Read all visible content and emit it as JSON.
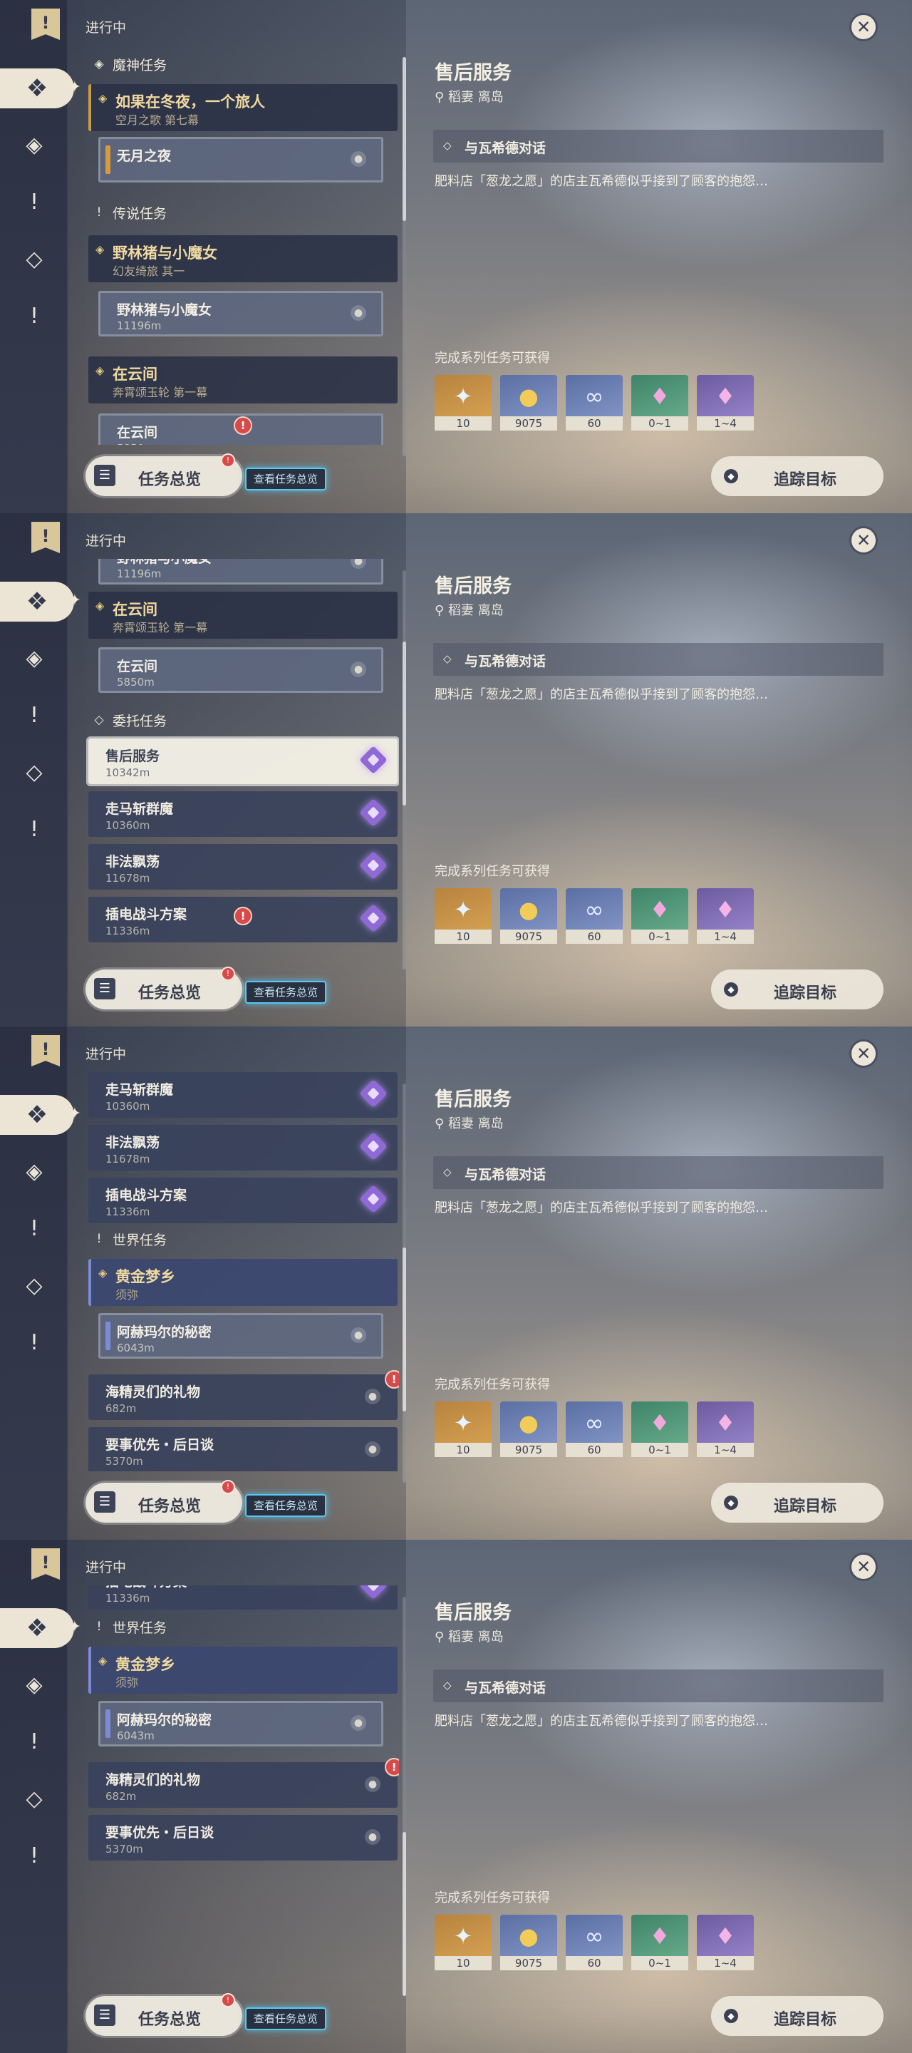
{
  "header": {
    "status_title": "进行中",
    "close_glyph": "✕"
  },
  "icons": {
    "quest_book": "quest-book-icon",
    "archon": "archon-quest-icon",
    "story": "story-quest-icon",
    "legend": "legend-quest-icon",
    "world": "world-quest-icon",
    "commission": "commission-quest-icon"
  },
  "detail": {
    "title": "售后服务",
    "location": "稻妻 离岛",
    "objective": "与瓦希德对话",
    "description": "肥料店「葱龙之愿」的店主瓦希德似乎接到了顾客的抱怨…",
    "rewards_label": "完成系列任务可获得",
    "rewards": [
      {
        "icon": "primogem-icon",
        "count": "10",
        "color": "#c58f46"
      },
      {
        "icon": "mora-icon",
        "count": "9075",
        "color": "#6c80b5"
      },
      {
        "icon": "companionship-exp-icon",
        "count": "60",
        "color": "#6c80b5"
      },
      {
        "icon": "crystal-green-icon",
        "count": "0~1",
        "color": "#4f9476"
      },
      {
        "icon": "crystal-purple-icon",
        "count": "1~4",
        "color": "#8070b5"
      }
    ]
  },
  "footer": {
    "overview_label": "任务总览",
    "overview_tag": "查看任务总览",
    "overview_alert": "!",
    "track_label": "追踪目标"
  },
  "categories": {
    "archon": "魔神任务",
    "legend": "传说任务",
    "commission": "委托任务",
    "world": "世界任务"
  },
  "quests": {
    "winter_night": {
      "title": "如果在冬夜，一个旅人",
      "sub": "空月之歌 第七幕"
    },
    "moonless": {
      "title": "无月之夜"
    },
    "boar_group": {
      "title": "野林猪与小魔女",
      "sub": "幻友绮旅 其一"
    },
    "boar_item": {
      "title": "野林猪与小魔女",
      "dist": "11196m"
    },
    "clouds_group": {
      "title": "在云间",
      "sub": "奔霄颂玉轮 第一幕"
    },
    "clouds_item": {
      "title": "在云间",
      "dist": "5850m"
    },
    "after_sales": {
      "title": "售后服务",
      "dist": "10342m"
    },
    "zouma": {
      "title": "走马斩群魔",
      "dist": "10360m"
    },
    "feifa": {
      "title": "非法飘荡",
      "dist": "11678m"
    },
    "chadian": {
      "title": "插电战斗方案",
      "dist": "11336m"
    },
    "golden_group": {
      "title": "黄金梦乡",
      "sub": "须弥"
    },
    "ahemar": {
      "title": "阿赫玛尔的秘密",
      "dist": "6043m"
    },
    "sea_spirits": {
      "title": "海精灵们的礼物",
      "dist": "682m"
    },
    "priority": {
      "title": "要事优先・后日谈",
      "dist": "5370m"
    }
  },
  "alert_glyph": "!"
}
